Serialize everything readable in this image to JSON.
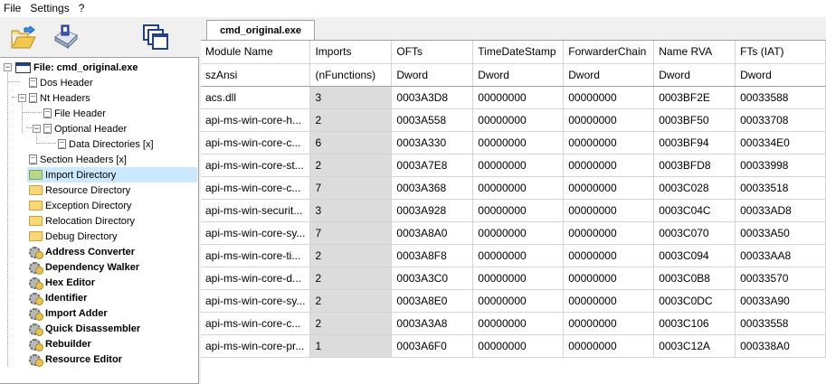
{
  "menu": [
    "File",
    "Settings",
    "?"
  ],
  "toolbar": {
    "open_icon": "open-folder-icon",
    "save_icon": "save-disk-icon",
    "windows_icon": "windows-icon"
  },
  "tab": {
    "label": "cmd_original.exe"
  },
  "tree": {
    "root": "File: cmd_original.exe",
    "dos_header": "Dos Header",
    "nt_headers": "Nt Headers",
    "file_header": "File Header",
    "optional_header": "Optional Header",
    "data_directories": "Data Directories [x]",
    "section_headers": "Section Headers [x]",
    "import_directory": "Import Directory",
    "resource_directory": "Resource Directory",
    "exception_directory": "Exception Directory",
    "relocation_directory": "Relocation Directory",
    "debug_directory": "Debug Directory",
    "address_converter": "Address Converter",
    "dependency_walker": "Dependency Walker",
    "hex_editor": "Hex Editor",
    "identifier": "Identifier",
    "import_adder": "Import Adder",
    "quick_disassembler": "Quick Disassembler",
    "rebuilder": "Rebuilder",
    "resource_editor": "Resource Editor"
  },
  "table": {
    "headers": [
      "Module Name",
      "Imports",
      "OFTs",
      "TimeDateStamp",
      "ForwarderChain",
      "Name RVA",
      "FTs (IAT)"
    ],
    "types": [
      "szAnsi",
      "(nFunctions)",
      "Dword",
      "Dword",
      "Dword",
      "Dword",
      "Dword"
    ],
    "rows": [
      [
        "acs.dll",
        "3",
        "0003A3D8",
        "00000000",
        "00000000",
        "0003BF2E",
        "00033588"
      ],
      [
        "api-ms-win-core-h...",
        "2",
        "0003A558",
        "00000000",
        "00000000",
        "0003BF50",
        "00033708"
      ],
      [
        "api-ms-win-core-c...",
        "6",
        "0003A330",
        "00000000",
        "00000000",
        "0003BF94",
        "000334E0"
      ],
      [
        "api-ms-win-core-st...",
        "2",
        "0003A7E8",
        "00000000",
        "00000000",
        "0003BFD8",
        "00033998"
      ],
      [
        "api-ms-win-core-c...",
        "7",
        "0003A368",
        "00000000",
        "00000000",
        "0003C028",
        "00033518"
      ],
      [
        "api-ms-win-securit...",
        "3",
        "0003A928",
        "00000000",
        "00000000",
        "0003C04C",
        "00033AD8"
      ],
      [
        "api-ms-win-core-sy...",
        "7",
        "0003A8A0",
        "00000000",
        "00000000",
        "0003C070",
        "00033A50"
      ],
      [
        "api-ms-win-core-ti...",
        "2",
        "0003A8F8",
        "00000000",
        "00000000",
        "0003C094",
        "00033AA8"
      ],
      [
        "api-ms-win-core-d...",
        "2",
        "0003A3C0",
        "00000000",
        "00000000",
        "0003C0B8",
        "00033570"
      ],
      [
        "api-ms-win-core-sy...",
        "2",
        "0003A8E0",
        "00000000",
        "00000000",
        "0003C0DC",
        "00033A90"
      ],
      [
        "api-ms-win-core-c...",
        "2",
        "0003A3A8",
        "00000000",
        "00000000",
        "0003C106",
        "00033558"
      ],
      [
        "api-ms-win-core-pr...",
        "1",
        "0003A6F0",
        "00000000",
        "00000000",
        "0003C12A",
        "000338A0"
      ]
    ]
  }
}
